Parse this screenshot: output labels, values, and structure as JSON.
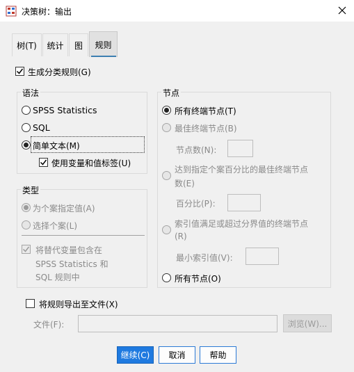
{
  "window": {
    "title": "决策树：输出"
  },
  "tabs": [
    {
      "label": "树(T)"
    },
    {
      "label": "统计"
    },
    {
      "label": "图"
    },
    {
      "label": "规则"
    }
  ],
  "generate_rules": {
    "label": "生成分类规则(G)",
    "checked": true
  },
  "syntax": {
    "title": "语法",
    "options": [
      {
        "label": "SPSS Statistics",
        "selected": false
      },
      {
        "label": "SQL",
        "selected": false
      },
      {
        "label": "简单文本(M)",
        "selected": true
      }
    ],
    "use_labels": {
      "label": "使用变量和值标签(U)",
      "checked": true
    }
  },
  "type": {
    "title": "类型",
    "options": [
      {
        "label": "为个案指定值(A)",
        "selected": true
      },
      {
        "label": "选择个案(L)",
        "selected": false
      }
    ],
    "include_surrogates": {
      "line1": "将替代变量包含在",
      "line2": "SPSS Statistics 和",
      "line3": "SQL 规则中",
      "checked": true
    }
  },
  "nodes": {
    "title": "节点",
    "all_terminal": "所有终端节点(T)",
    "best_terminal": "最佳终端节点(B)",
    "node_count_label": "节点数(N):",
    "best_percent_line1": "达到指定个案百分比的最佳终端节点",
    "best_percent_line2": "数(E)",
    "percent_label": "百分比(P):",
    "index_line1": "索引值满足或超过分界值的终端节点",
    "index_line2": "(R)",
    "min_index_label": "最小索引值(V):",
    "all_nodes": "所有节点(O)"
  },
  "export": {
    "label": "将规则导出至文件(X)",
    "checked": false,
    "file_label": "文件(F):",
    "file_value": "",
    "browse_label": "浏览(W)..."
  },
  "buttons": {
    "continue": "继续(C)",
    "cancel": "取消",
    "help": "帮助"
  },
  "colors": {
    "accent": "#1f7ae0",
    "tab_underline": "#3c7fb1"
  }
}
